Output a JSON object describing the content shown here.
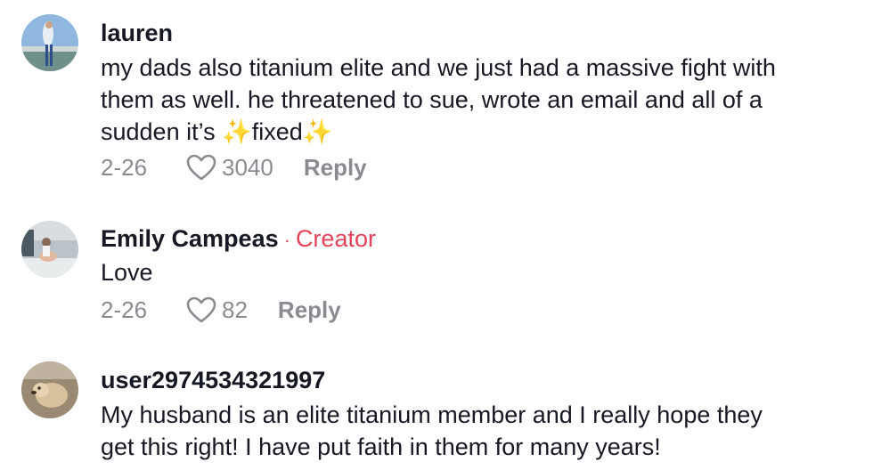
{
  "comments": [
    {
      "username": "lauren",
      "text_before": "my dads also titanium elite and we just had a massive fight with\nthem as well. he threatened to sue, wrote an email and all of a\nsudden it’s ",
      "sparkle": "✨",
      "text_mid": "fixed",
      "date": "2-26",
      "likes": "3040",
      "reply_label": "Reply"
    },
    {
      "username": "Emily Campeas",
      "creator_separator": "·",
      "creator_label": "Creator",
      "text": "Love",
      "date": "2-26",
      "likes": "82",
      "reply_label": "Reply"
    },
    {
      "username": "user2974534321997",
      "text": "My husband is an elite titanium member and I really hope they\nget this right! I have put faith in them for many years!"
    }
  ],
  "icons": {
    "like": "heart-outline-icon"
  }
}
